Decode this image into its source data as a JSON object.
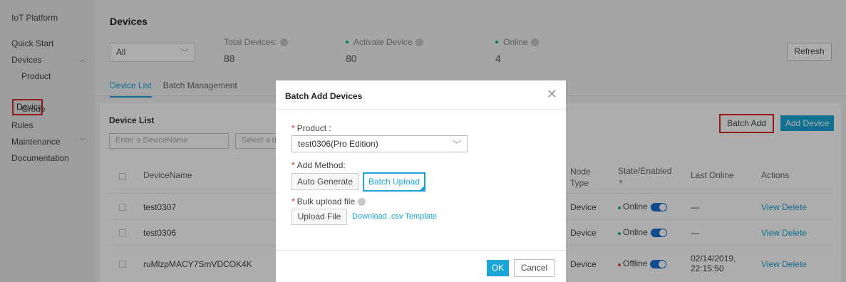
{
  "sidebar": {
    "header": "IoT Platform",
    "items": [
      {
        "label": "Quick Start"
      },
      {
        "label": "Devices"
      },
      {
        "label": "Product"
      },
      {
        "label": "Device"
      },
      {
        "label": "Group"
      },
      {
        "label": "Rules"
      },
      {
        "label": "Maintenance"
      },
      {
        "label": "Documentation"
      }
    ]
  },
  "header": {
    "title": "Devices",
    "product_filter": "All",
    "refresh_label": "Refresh",
    "stats": [
      {
        "label": "Total Devices:",
        "value": "88"
      },
      {
        "label": "Activate Device",
        "value": "80"
      },
      {
        "label": "Online",
        "value": "4"
      }
    ]
  },
  "tabs": [
    {
      "label": "Device List"
    },
    {
      "label": "Batch Management"
    }
  ],
  "device_list": {
    "title": "Device List",
    "search_placeholder": "Enter a DeviceName",
    "select_placeholder": "Select a d",
    "batch_add_label": "Batch Add",
    "add_device_label": "Add Device",
    "columns": {
      "name": "DeviceName",
      "node_type": "Node Type",
      "state": "State/Enabled",
      "last_online": "Last Online",
      "actions": "Actions"
    },
    "rows": [
      {
        "name": "test0307",
        "node_type": "Device",
        "state": "Online",
        "last_online": "—",
        "view": "View",
        "delete": "Delete"
      },
      {
        "name": "test0306",
        "node_type": "Device",
        "state": "Online",
        "last_online": "—",
        "view": "View",
        "delete": "Delete"
      },
      {
        "name": "ruMlzpMACY7SmVDCOK4K",
        "node_type": "Device",
        "state": "Offline",
        "last_online_date": "02/14/2019,",
        "last_online_time": "22:15:50",
        "view": "View",
        "delete": "Delete"
      }
    ]
  },
  "modal": {
    "title": "Batch Add Devices",
    "product_label": "Product :",
    "product_value": "test0306(Pro Edition)",
    "method_label": "Add Method:",
    "auto_generate_label": "Auto Generate",
    "batch_upload_label": "Batch Upload",
    "bulk_label": "Bulk upload file",
    "upload_file_label": "Upload File",
    "download_label": "Download .csv Template",
    "ok_label": "OK",
    "cancel_label": "Cancel"
  },
  "colors": {
    "accent": "#1aa6d6",
    "highlight_red": "#d9272e",
    "online_green": "#1bb35c",
    "toggle_blue": "#1a6ecf"
  }
}
